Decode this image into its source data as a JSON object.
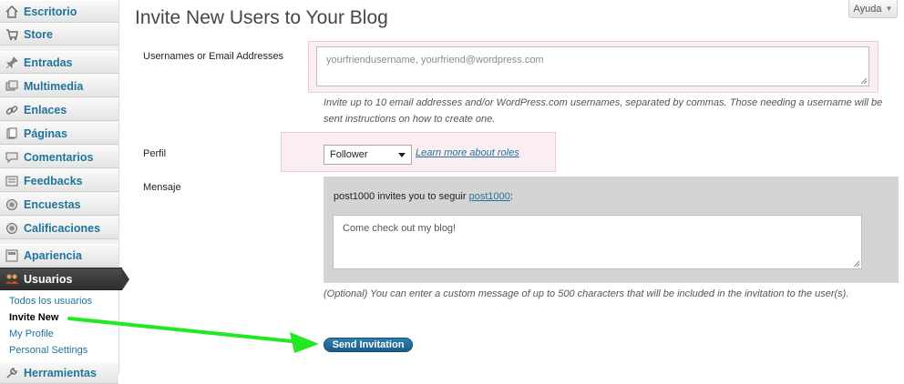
{
  "sidebar": {
    "items": [
      {
        "label": "Escritorio",
        "icon": "house-icon"
      },
      {
        "label": "Store",
        "icon": "cart-icon"
      },
      {
        "label": "Entradas",
        "icon": "pin-icon"
      },
      {
        "label": "Multimedia",
        "icon": "media-icon"
      },
      {
        "label": "Enlaces",
        "icon": "link-icon"
      },
      {
        "label": "Páginas",
        "icon": "pages-icon"
      },
      {
        "label": "Comentarios",
        "icon": "comment-bubble-icon"
      },
      {
        "label": "Feedbacks",
        "icon": "feedback-icon"
      },
      {
        "label": "Encuestas",
        "icon": "polls-icon"
      },
      {
        "label": "Calificaciones",
        "icon": "ratings-icon"
      },
      {
        "label": "Apariencia",
        "icon": "appearance-icon"
      },
      {
        "label": "Usuarios",
        "icon": "users-icon"
      },
      {
        "label": "Herramientas",
        "icon": "tools-icon"
      }
    ],
    "submenu": [
      {
        "label": "Todos los usuarios"
      },
      {
        "label": "Invite New"
      },
      {
        "label": "My Profile"
      },
      {
        "label": "Personal Settings"
      }
    ]
  },
  "header": {
    "help_label": "Ayuda",
    "title": "Invite New Users to Your Blog"
  },
  "form": {
    "usernames_label": "Usernames or Email Addresses",
    "usernames_placeholder": "yourfriendusername, yourfriend@wordpress.com",
    "usernames_help": "Invite up to 10 email addresses and/or WordPress.com usernames, separated by commas. Those needing a username will be sent instructions on how to create one.",
    "role_label": "Perfil",
    "role_value": "Follower",
    "roles_link": "Learn more about roles",
    "message_label": "Mensaje",
    "invite_prefix": "post1000 invites you to seguir ",
    "invite_link": "post1000",
    "invite_suffix": ":",
    "message_value": "Come check out my blog!",
    "message_help": "(Optional) You can enter a custom message of up to 500 characters that will be included in the invitation to the user(s).",
    "send_label": "Send Invitation"
  },
  "colors": {
    "link": "#21759b",
    "arrow": "#22e822",
    "button": "#21759b",
    "highlight_pink": "#fbeef3"
  }
}
